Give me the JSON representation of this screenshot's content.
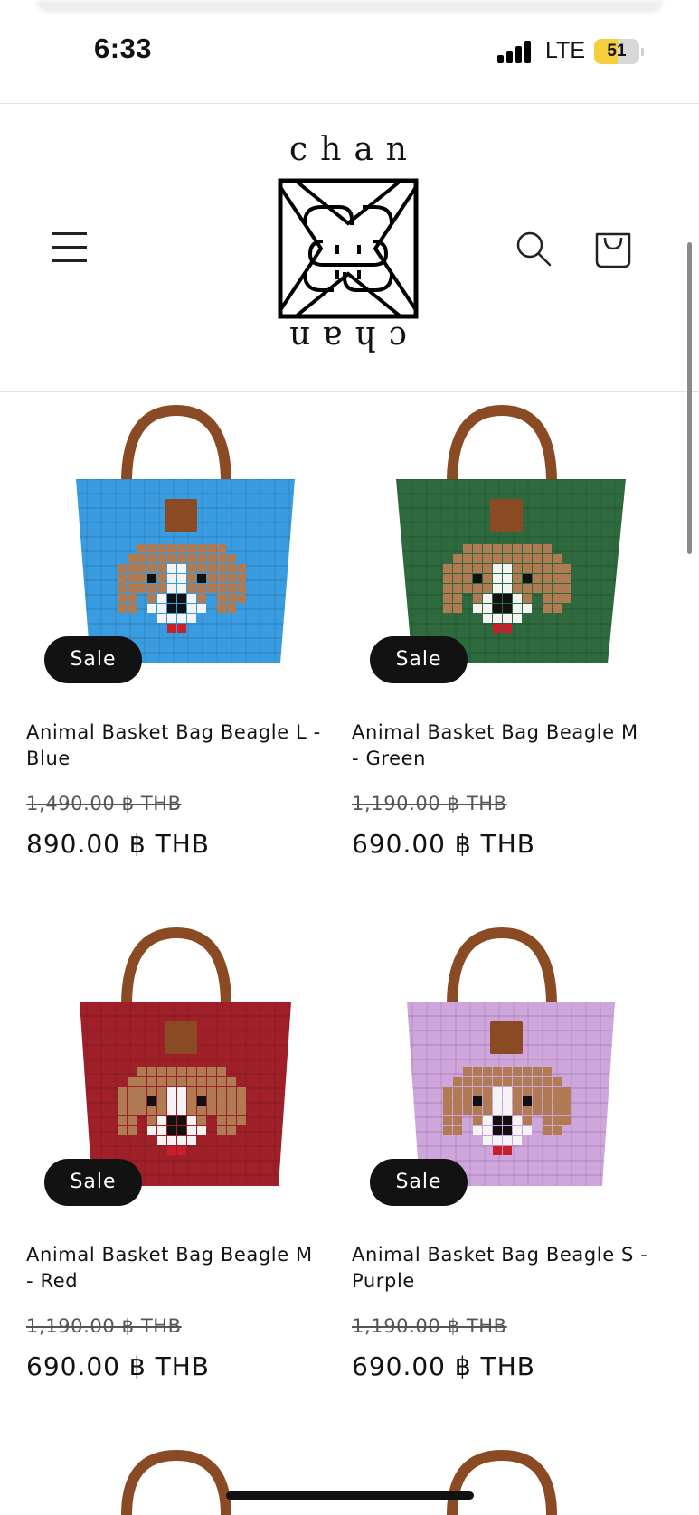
{
  "status_bar": {
    "time": "6:33",
    "network": "LTE",
    "battery": "51",
    "battery_level": 0.51
  },
  "header": {
    "logo_top": "chan",
    "logo_bottom": "chan",
    "menu_icon": "hamburger-menu-icon",
    "search_icon": "search-icon",
    "cart_icon": "cart-bag-icon"
  },
  "products": [
    {
      "title": "Animal Basket Bag Beagle L - Blue",
      "badge": "Sale",
      "price_old": "1,490.00 ฿ THB",
      "price_new": "890.00 ฿ THB",
      "bag_color": "#3a9ce0"
    },
    {
      "title": "Animal Basket Bag Beagle M - Green",
      "badge": "Sale",
      "price_old": "1,190.00 ฿ THB",
      "price_new": "690.00 ฿ THB",
      "bag_color": "#2e6a3e"
    },
    {
      "title": "Animal Basket Bag Beagle M - Red",
      "badge": "Sale",
      "price_old": "1,190.00 ฿ THB",
      "price_new": "690.00 ฿ THB",
      "bag_color": "#a0202a"
    },
    {
      "title": "Animal Basket Bag Beagle S - Purple",
      "badge": "Sale",
      "price_old": "1,190.00 ฿ THB",
      "price_new": "690.00 ฿ THB",
      "bag_color": "#cfa6dc"
    }
  ],
  "colors": {
    "badge_bg": "#121212",
    "handle": "#8a4a24",
    "beagle_brown": "#b07a52",
    "beagle_white": "#f4f4f4"
  }
}
